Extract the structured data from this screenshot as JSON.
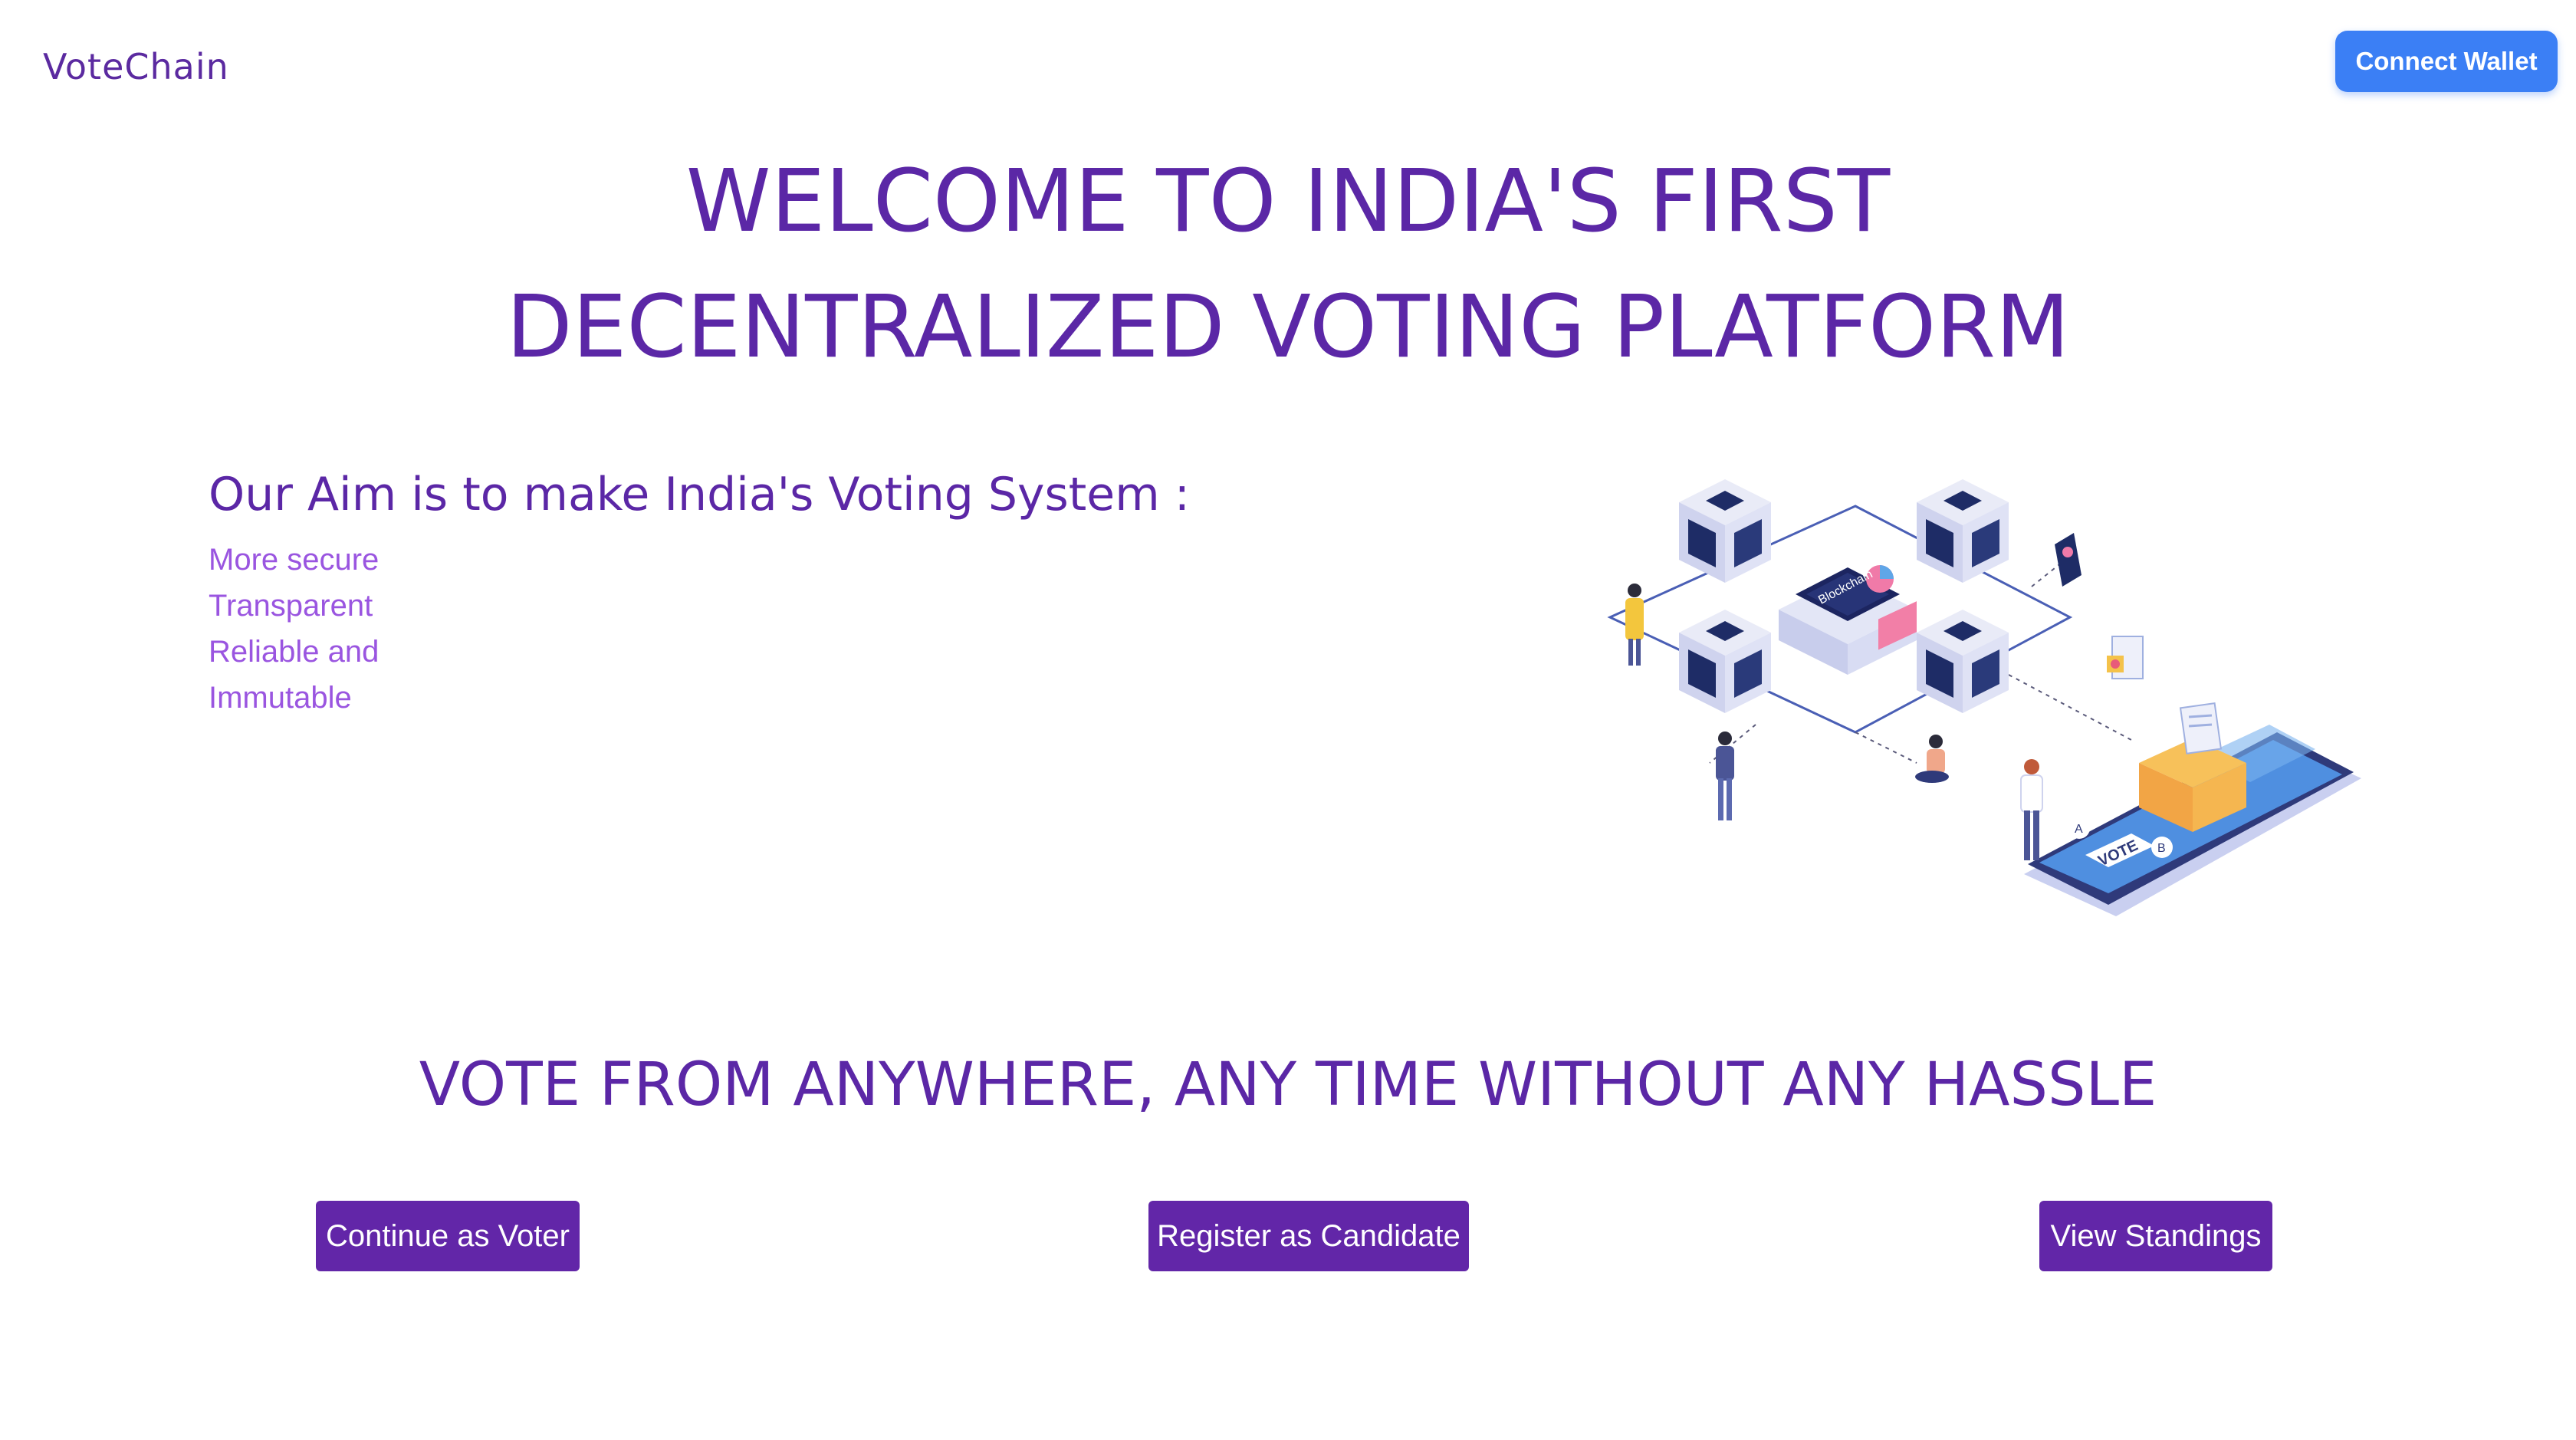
{
  "header": {
    "brand": "VoteChain",
    "connect_wallet_label": "Connect Wallet"
  },
  "hero": {
    "line1": "WELCOME TO INDIA'S FIRST",
    "line2": "DECENTRALIZED VOTING PLATFORM"
  },
  "aim": {
    "heading": "Our Aim is to make India's Voting System :",
    "items": [
      "More secure",
      "Transparent",
      "Reliable and",
      "Immutable"
    ]
  },
  "illustration": {
    "block_label": "Blockchain",
    "vote_label": "VOTE",
    "option_a": "A",
    "option_b": "B"
  },
  "tagline": "VOTE FROM ANYWHERE, ANY TIME WITHOUT ANY HASSLE",
  "actions": {
    "voter_label": "Continue as Voter",
    "candidate_label": "Register as Candidate",
    "standings_label": "View Standings"
  },
  "colors": {
    "primary_purple": "#5b27a6",
    "button_purple": "#6226a8",
    "list_purple": "#9a55e0",
    "wallet_blue": "#3b7ff5"
  }
}
